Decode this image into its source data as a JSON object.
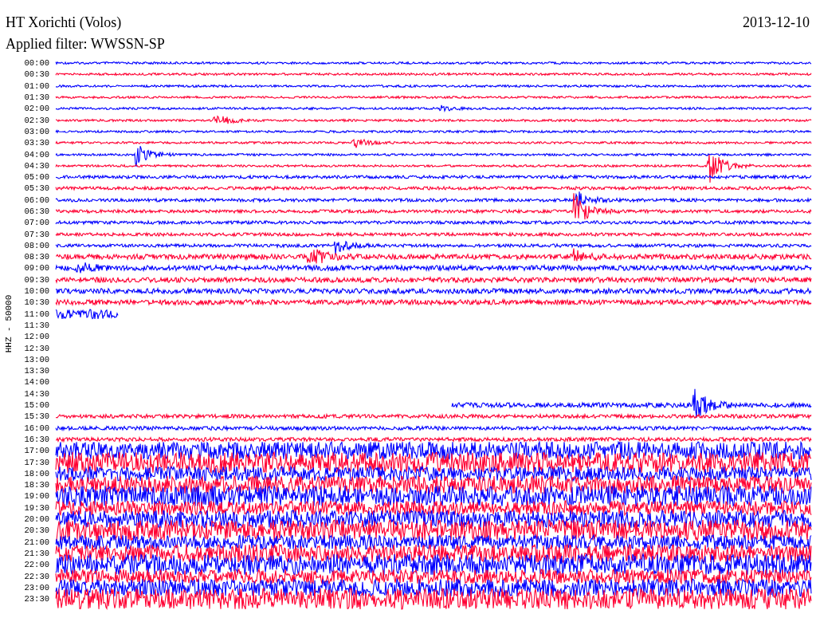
{
  "header": {
    "station": "HT Xorichti (Volos)",
    "date": "2013-12-10",
    "filter": "Applied filter: WWSSN-SP"
  },
  "axis_label": "HHZ - 50000",
  "rows": [
    {
      "time": "00:00",
      "color": "#0000ff",
      "kind": "full"
    },
    {
      "time": "00:30",
      "color": "#ff0033",
      "kind": "full"
    },
    {
      "time": "01:00",
      "color": "#0000ff",
      "kind": "full"
    },
    {
      "time": "01:30",
      "color": "#ff0033",
      "kind": "full"
    },
    {
      "time": "02:00",
      "color": "#0000ff",
      "kind": "full"
    },
    {
      "time": "02:30",
      "color": "#ff0033",
      "kind": "full"
    },
    {
      "time": "03:00",
      "color": "#0000ff",
      "kind": "full"
    },
    {
      "time": "03:30",
      "color": "#ff0033",
      "kind": "full"
    },
    {
      "time": "04:00",
      "color": "#0000ff",
      "kind": "full"
    },
    {
      "time": "04:30",
      "color": "#ff0033",
      "kind": "full"
    },
    {
      "time": "05:00",
      "color": "#0000ff",
      "kind": "full"
    },
    {
      "time": "05:30",
      "color": "#ff0033",
      "kind": "full"
    },
    {
      "time": "06:00",
      "color": "#0000ff",
      "kind": "full"
    },
    {
      "time": "06:30",
      "color": "#ff0033",
      "kind": "full"
    },
    {
      "time": "07:00",
      "color": "#0000ff",
      "kind": "full"
    },
    {
      "time": "07:30",
      "color": "#ff0033",
      "kind": "full"
    },
    {
      "time": "08:00",
      "color": "#0000ff",
      "kind": "full"
    },
    {
      "time": "08:30",
      "color": "#ff0033",
      "kind": "full"
    },
    {
      "time": "09:00",
      "color": "#0000ff",
      "kind": "full"
    },
    {
      "time": "09:30",
      "color": "#ff0033",
      "kind": "full"
    },
    {
      "time": "10:00",
      "color": "#0000ff",
      "kind": "full"
    },
    {
      "time": "10:30",
      "color": "#ff0033",
      "kind": "full"
    },
    {
      "time": "11:00",
      "color": "#0000ff",
      "kind": "ends-early"
    },
    {
      "time": "11:30",
      "kind": "empty"
    },
    {
      "time": "12:00",
      "kind": "empty"
    },
    {
      "time": "12:30",
      "kind": "empty"
    },
    {
      "time": "13:00",
      "kind": "empty"
    },
    {
      "time": "13:30",
      "kind": "empty"
    },
    {
      "time": "14:00",
      "kind": "empty"
    },
    {
      "time": "14:30",
      "kind": "empty"
    },
    {
      "time": "15:00",
      "color": "#0000ff",
      "kind": "starts-late"
    },
    {
      "time": "15:30",
      "color": "#ff0033",
      "kind": "full"
    },
    {
      "time": "16:00",
      "color": "#0000ff",
      "kind": "full"
    },
    {
      "time": "16:30",
      "color": "#ff0033",
      "kind": "full"
    },
    {
      "time": "17:00",
      "color": "#0000ff",
      "kind": "full"
    },
    {
      "time": "17:30",
      "color": "#ff0033",
      "kind": "full"
    },
    {
      "time": "18:00",
      "color": "#0000ff",
      "kind": "full"
    },
    {
      "time": "18:30",
      "color": "#ff0033",
      "kind": "full"
    },
    {
      "time": "19:00",
      "color": "#0000ff",
      "kind": "full"
    },
    {
      "time": "19:30",
      "color": "#ff0033",
      "kind": "full"
    },
    {
      "time": "20:00",
      "color": "#0000ff",
      "kind": "full"
    },
    {
      "time": "20:30",
      "color": "#ff0033",
      "kind": "full"
    },
    {
      "time": "21:00",
      "color": "#0000ff",
      "kind": "full"
    },
    {
      "time": "21:30",
      "color": "#ff0033",
      "kind": "full"
    },
    {
      "time": "22:00",
      "color": "#0000ff",
      "kind": "full"
    },
    {
      "time": "22:30",
      "color": "#ff0033",
      "kind": "full"
    },
    {
      "time": "23:00",
      "color": "#0000ff",
      "kind": "full"
    },
    {
      "time": "23:30",
      "color": "#ff0033",
      "kind": "full"
    }
  ]
}
